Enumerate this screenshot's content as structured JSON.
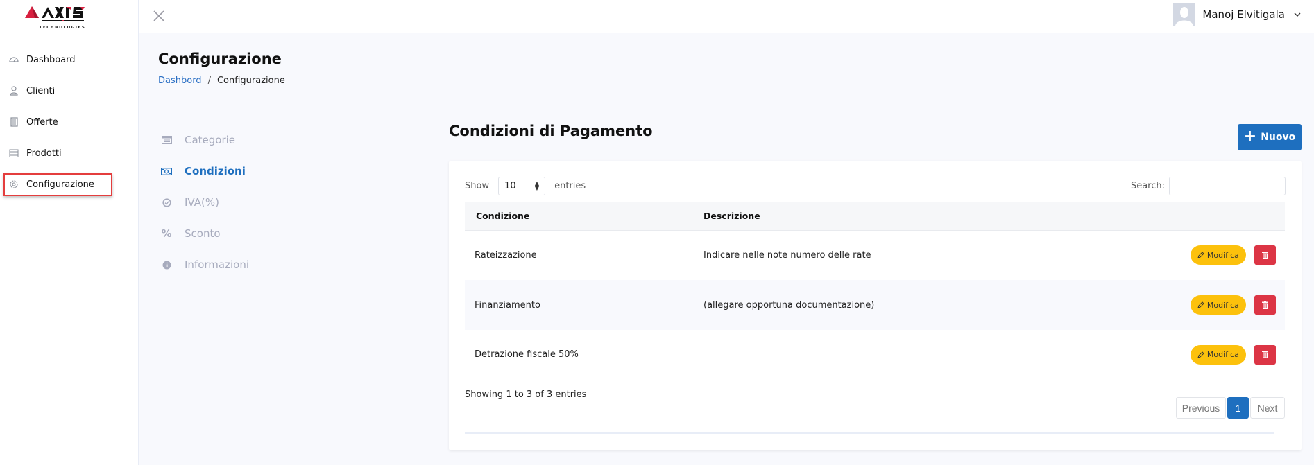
{
  "brand": {
    "name": "AXIS",
    "tagline": "TECHNOLOGIES"
  },
  "sidebar": {
    "items": [
      {
        "label": "Dashboard",
        "icon": "dashboard-gauge-icon"
      },
      {
        "label": "Clienti",
        "icon": "user-icon"
      },
      {
        "label": "Offerte",
        "icon": "receipt-icon"
      },
      {
        "label": "Prodotti",
        "icon": "list-icon"
      },
      {
        "label": "Configurazione",
        "icon": "gear-icon",
        "active": true
      }
    ]
  },
  "header": {
    "close_icon": "close-icon",
    "user_name": "Manoj Elvitigala"
  },
  "page": {
    "title": "Configurazione",
    "breadcrumb": {
      "home": "Dashbord",
      "separator": "/",
      "current": "Configurazione"
    }
  },
  "subnav": {
    "items": [
      {
        "label": "Categorie",
        "icon": "list-alt-icon"
      },
      {
        "label": "Condizioni",
        "icon": "money-bill-icon",
        "active": true
      },
      {
        "label": "IVA(%)",
        "icon": "check-circle-icon"
      },
      {
        "label": "Sconto",
        "icon": "percent-icon"
      },
      {
        "label": "Informazioni",
        "icon": "info-circle-icon"
      }
    ]
  },
  "section": {
    "title": "Condizioni di Pagamento",
    "new_button": "Nuovo"
  },
  "table": {
    "length": {
      "show": "Show",
      "value": "10",
      "entries": "entries"
    },
    "search_label": "Search:",
    "search_value": "",
    "columns": [
      "Condizione",
      "Descrizione"
    ],
    "rows": [
      {
        "condizione": "Rateizzazione",
        "descrizione": "Indicare nelle note numero delle rate",
        "edit": "Modifica"
      },
      {
        "condizione": "Finanziamento",
        "descrizione": "(allegare opportuna documentazione)",
        "edit": "Modifica"
      },
      {
        "condizione": "Detrazione fiscale 50%",
        "descrizione": "",
        "edit": "Modifica"
      }
    ],
    "info": "Showing 1 to 3 of 3 entries",
    "pagination": {
      "previous": "Previous",
      "current": "1",
      "next": "Next"
    }
  },
  "colors": {
    "primary": "#1e6fbf",
    "warning": "#fcc10c",
    "danger": "#dc3545",
    "highlight": "#e43d3d",
    "logo_red": "#d81f3f"
  }
}
